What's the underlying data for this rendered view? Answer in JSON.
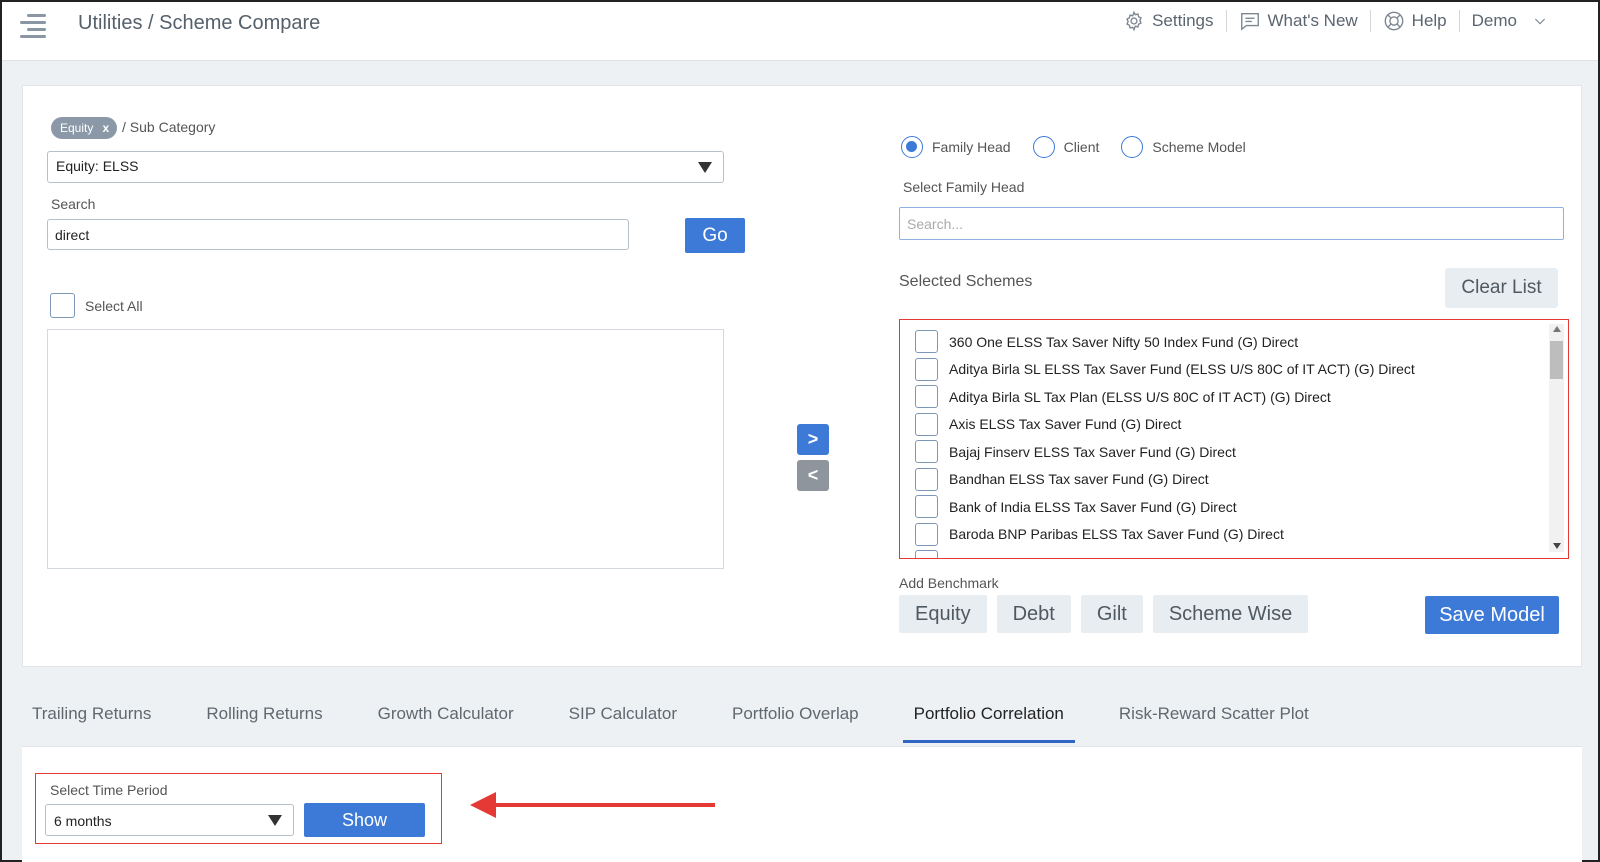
{
  "header": {
    "breadcrumb": "Utilities / Scheme Compare",
    "actions": [
      {
        "icon": "gear-icon",
        "label": "Settings"
      },
      {
        "icon": "message-icon",
        "label": "What's New"
      },
      {
        "icon": "help-ring-icon",
        "label": "Help"
      },
      {
        "icon": "chevron-down-icon",
        "label": "Demo"
      }
    ]
  },
  "left": {
    "category_chip": "Equity",
    "chip_close": "x",
    "subcategory_label": "/ Sub Category",
    "subcategory_value": "Equity: ELSS",
    "search_label": "Search",
    "search_value": "direct",
    "go_label": "Go",
    "select_all_label": "Select All"
  },
  "transfer": {
    "add": ">",
    "remove": "<"
  },
  "right": {
    "radio_options": [
      "Family Head",
      "Client",
      "Scheme Model"
    ],
    "radio_selected": "Family Head",
    "family_label": "Select Family Head",
    "family_placeholder": "Search...",
    "selected_label": "Selected Schemes",
    "clear_label": "Clear List",
    "schemes": [
      "360 One ELSS Tax Saver Nifty 50 Index Fund (G) Direct",
      "Aditya Birla SL ELSS Tax Saver Fund (ELSS U/S 80C of IT ACT) (G) Direct",
      "Aditya Birla SL Tax Plan (ELSS U/S 80C of IT ACT) (G) Direct",
      "Axis ELSS Tax Saver Fund (G) Direct",
      "Bajaj Finserv ELSS Tax Saver Fund (G) Direct",
      "Bandhan ELSS Tax saver Fund (G) Direct",
      "Bank of India ELSS Tax Saver Fund (G) Direct",
      "Baroda BNP Paribas ELSS Tax Saver Fund (G) Direct"
    ],
    "benchmark_label": "Add Benchmark",
    "benchmarks": [
      "Equity",
      "Debt",
      "Gilt",
      "Scheme Wise"
    ],
    "save_label": "Save Model"
  },
  "tabs": [
    "Trailing Returns",
    "Rolling Returns",
    "Growth Calculator",
    "SIP Calculator",
    "Portfolio Overlap",
    "Portfolio Correlation",
    "Risk-Reward Scatter Plot"
  ],
  "active_tab": "Portfolio Correlation",
  "period": {
    "label": "Select Time Period",
    "value": "6 months",
    "show_label": "Show"
  },
  "colors": {
    "primary": "#3d7ad8",
    "annotation": "#e53935"
  }
}
